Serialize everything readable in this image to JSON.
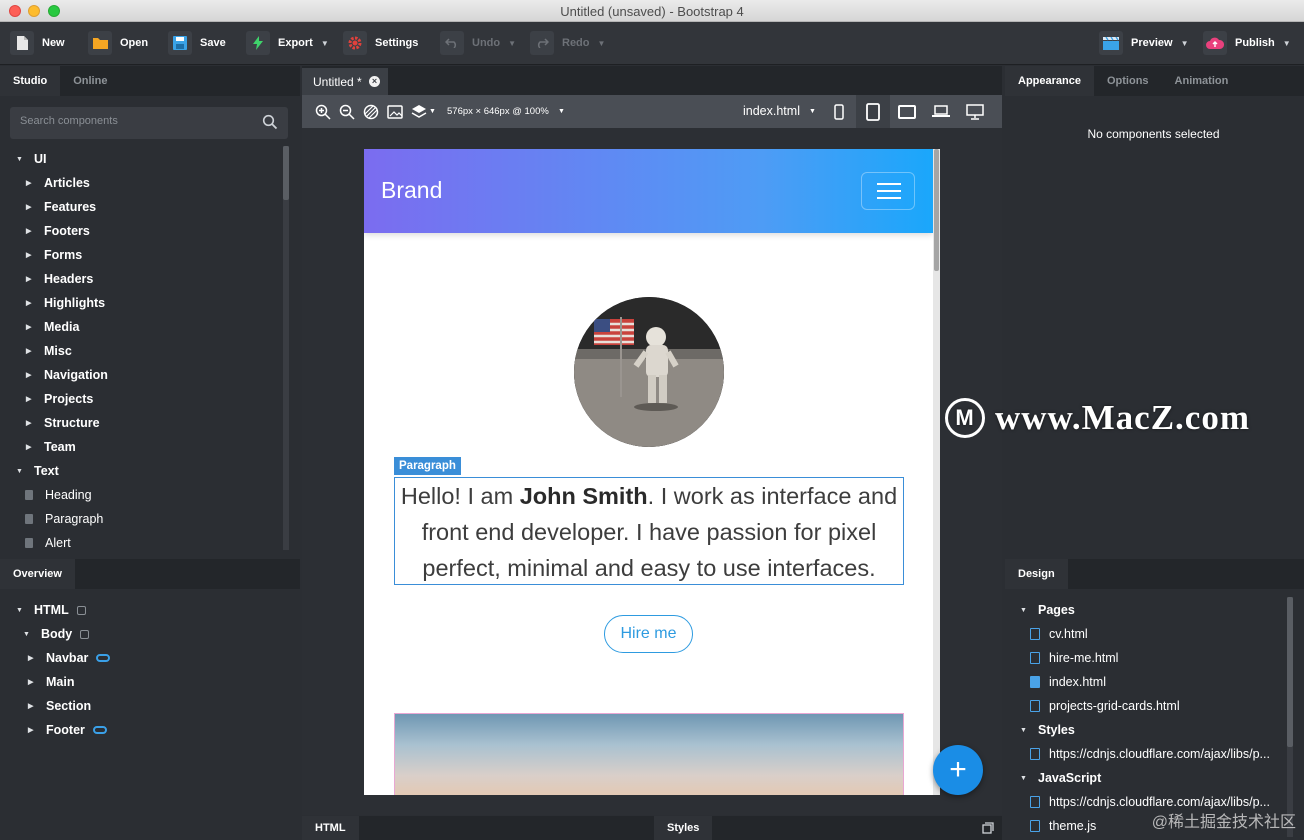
{
  "window": {
    "title": "Untitled (unsaved) - Bootstrap 4"
  },
  "toolbar": {
    "new": "New",
    "open": "Open",
    "save": "Save",
    "export": "Export",
    "settings": "Settings",
    "undo": "Undo",
    "redo": "Redo",
    "preview": "Preview",
    "publish": "Publish"
  },
  "left_tabs": {
    "studio": "Studio",
    "online": "Online"
  },
  "search": {
    "placeholder": "Search components"
  },
  "components": {
    "ui_group": "UI",
    "ui_items": [
      "Articles",
      "Features",
      "Footers",
      "Forms",
      "Headers",
      "Highlights",
      "Media",
      "Misc",
      "Navigation",
      "Projects",
      "Structure",
      "Team"
    ],
    "text_group": "Text",
    "text_items": [
      "Heading",
      "Paragraph",
      "Alert"
    ]
  },
  "overview": {
    "tab": "Overview",
    "html": "HTML",
    "body": "Body",
    "children": [
      "Navbar",
      "Main",
      "Section",
      "Footer"
    ]
  },
  "document_tab": "Untitled *",
  "canvas_toolbar": {
    "size": "576px × 646px @ 100%",
    "page_select": "index.html"
  },
  "preview_page": {
    "brand": "Brand",
    "para_label": "Paragraph",
    "para_pre": "Hello! I am ",
    "para_name": "John Smith",
    "para_post": ". I work as interface and front end developer. I have passion for pixel perfect, minimal and easy to use interfaces.",
    "hire_button": "Hire me"
  },
  "bottom_tabs": {
    "html": "HTML",
    "styles": "Styles"
  },
  "right_tabs": {
    "appearance": "Appearance",
    "options": "Options",
    "animation": "Animation"
  },
  "right_message": "No components selected",
  "design": {
    "tab": "Design",
    "pages_label": "Pages",
    "pages": [
      "cv.html",
      "hire-me.html",
      "index.html",
      "projects-grid-cards.html"
    ],
    "styles_label": "Styles",
    "styles": [
      "https://cdnjs.cloudflare.com/ajax/libs/p..."
    ],
    "js_label": "JavaScript",
    "js": [
      "https://cdnjs.cloudflare.com/ajax/libs/p...",
      "theme.js"
    ]
  },
  "watermark": "www.MacZ.com",
  "corner_watermark": "@稀土掘金技术社区",
  "colors": {
    "accent": "#1a8de6",
    "selection": "#3a8ed8",
    "toolbar": "#32353a",
    "panel": "#2b2e33"
  }
}
